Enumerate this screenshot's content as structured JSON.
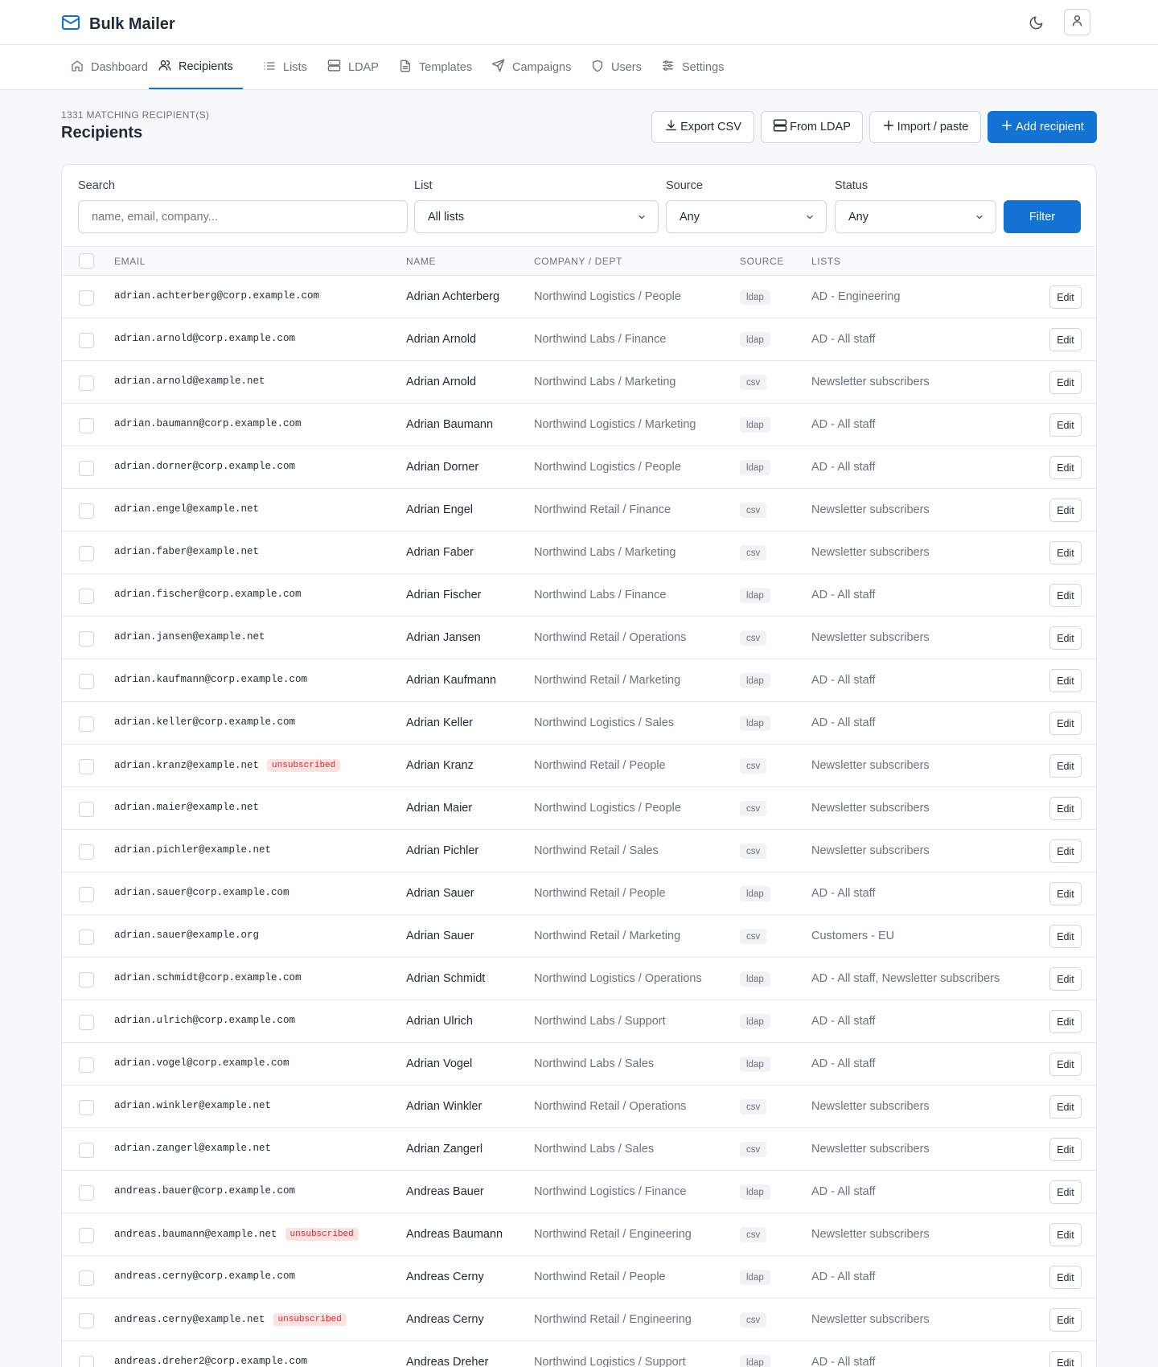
{
  "app": {
    "title": "Bulk Mailer"
  },
  "nav": {
    "tabs": [
      {
        "label": "Dashboard",
        "icon": "home-icon"
      },
      {
        "label": "Recipients",
        "icon": "users-icon",
        "active": true
      },
      {
        "label": "Lists",
        "icon": "list-icon"
      },
      {
        "label": "LDAP",
        "icon": "server-icon"
      },
      {
        "label": "Templates",
        "icon": "file-icon"
      },
      {
        "label": "Campaigns",
        "icon": "send-icon"
      },
      {
        "label": "Users",
        "icon": "shield-icon"
      },
      {
        "label": "Settings",
        "icon": "sliders-icon"
      }
    ]
  },
  "header": {
    "count_label": "1331 MATCHING RECIPIENT(S)",
    "title": "Recipients",
    "buttons": {
      "export": "Export CSV",
      "ldap": "From LDAP",
      "import": "Import / paste",
      "add": "Add recipient"
    }
  },
  "filters": {
    "search_label": "Search",
    "search_placeholder": "name, email, company...",
    "list_label": "List",
    "list_value": "All lists",
    "source_label": "Source",
    "source_value": "Any",
    "status_label": "Status",
    "status_value": "Any",
    "filter_button": "Filter"
  },
  "table": {
    "columns": {
      "email": "EMAIL",
      "name": "NAME",
      "company": "COMPANY / DEPT",
      "source": "SOURCE",
      "lists": "LISTS"
    },
    "edit_label": "Edit",
    "unsubscribed_label": "unsubscribed",
    "rows": [
      {
        "email": "adrian.achterberg@corp.example.com",
        "name": "Adrian Achterberg",
        "company": "Northwind Logistics / People",
        "source": "ldap",
        "lists": "AD - Engineering",
        "unsubscribed": false
      },
      {
        "email": "adrian.arnold@corp.example.com",
        "name": "Adrian Arnold",
        "company": "Northwind Labs / Finance",
        "source": "ldap",
        "lists": "AD - All staff",
        "unsubscribed": false
      },
      {
        "email": "adrian.arnold@example.net",
        "name": "Adrian Arnold",
        "company": "Northwind Labs / Marketing",
        "source": "csv",
        "lists": "Newsletter subscribers",
        "unsubscribed": false
      },
      {
        "email": "adrian.baumann@corp.example.com",
        "name": "Adrian Baumann",
        "company": "Northwind Logistics / Marketing",
        "source": "ldap",
        "lists": "AD - All staff",
        "unsubscribed": false
      },
      {
        "email": "adrian.dorner@corp.example.com",
        "name": "Adrian Dorner",
        "company": "Northwind Logistics / People",
        "source": "ldap",
        "lists": "AD - All staff",
        "unsubscribed": false
      },
      {
        "email": "adrian.engel@example.net",
        "name": "Adrian Engel",
        "company": "Northwind Retail / Finance",
        "source": "csv",
        "lists": "Newsletter subscribers",
        "unsubscribed": false
      },
      {
        "email": "adrian.faber@example.net",
        "name": "Adrian Faber",
        "company": "Northwind Labs / Marketing",
        "source": "csv",
        "lists": "Newsletter subscribers",
        "unsubscribed": false
      },
      {
        "email": "adrian.fischer@corp.example.com",
        "name": "Adrian Fischer",
        "company": "Northwind Labs / Finance",
        "source": "ldap",
        "lists": "AD - All staff",
        "unsubscribed": false
      },
      {
        "email": "adrian.jansen@example.net",
        "name": "Adrian Jansen",
        "company": "Northwind Retail / Operations",
        "source": "csv",
        "lists": "Newsletter subscribers",
        "unsubscribed": false
      },
      {
        "email": "adrian.kaufmann@corp.example.com",
        "name": "Adrian Kaufmann",
        "company": "Northwind Retail / Marketing",
        "source": "ldap",
        "lists": "AD - All staff",
        "unsubscribed": false
      },
      {
        "email": "adrian.keller@corp.example.com",
        "name": "Adrian Keller",
        "company": "Northwind Logistics / Sales",
        "source": "ldap",
        "lists": "AD - All staff",
        "unsubscribed": false
      },
      {
        "email": "adrian.kranz@example.net",
        "name": "Adrian Kranz",
        "company": "Northwind Retail / People",
        "source": "csv",
        "lists": "Newsletter subscribers",
        "unsubscribed": true
      },
      {
        "email": "adrian.maier@example.net",
        "name": "Adrian Maier",
        "company": "Northwind Logistics / People",
        "source": "csv",
        "lists": "Newsletter subscribers",
        "unsubscribed": false
      },
      {
        "email": "adrian.pichler@example.net",
        "name": "Adrian Pichler",
        "company": "Northwind Retail / Sales",
        "source": "csv",
        "lists": "Newsletter subscribers",
        "unsubscribed": false
      },
      {
        "email": "adrian.sauer@corp.example.com",
        "name": "Adrian Sauer",
        "company": "Northwind Retail / People",
        "source": "ldap",
        "lists": "AD - All staff",
        "unsubscribed": false
      },
      {
        "email": "adrian.sauer@example.org",
        "name": "Adrian Sauer",
        "company": "Northwind Retail / Marketing",
        "source": "csv",
        "lists": "Customers - EU",
        "unsubscribed": false
      },
      {
        "email": "adrian.schmidt@corp.example.com",
        "name": "Adrian Schmidt",
        "company": "Northwind Logistics / Operations",
        "source": "ldap",
        "lists": "AD - All staff, Newsletter subscribers",
        "unsubscribed": false
      },
      {
        "email": "adrian.ulrich@corp.example.com",
        "name": "Adrian Ulrich",
        "company": "Northwind Labs / Support",
        "source": "ldap",
        "lists": "AD - All staff",
        "unsubscribed": false
      },
      {
        "email": "adrian.vogel@corp.example.com",
        "name": "Adrian Vogel",
        "company": "Northwind Labs / Sales",
        "source": "ldap",
        "lists": "AD - All staff",
        "unsubscribed": false
      },
      {
        "email": "adrian.winkler@example.net",
        "name": "Adrian Winkler",
        "company": "Northwind Retail / Operations",
        "source": "csv",
        "lists": "Newsletter subscribers",
        "unsubscribed": false
      },
      {
        "email": "adrian.zangerl@example.net",
        "name": "Adrian Zangerl",
        "company": "Northwind Labs / Sales",
        "source": "csv",
        "lists": "Newsletter subscribers",
        "unsubscribed": false
      },
      {
        "email": "andreas.bauer@corp.example.com",
        "name": "Andreas Bauer",
        "company": "Northwind Logistics / Finance",
        "source": "ldap",
        "lists": "AD - All staff",
        "unsubscribed": false
      },
      {
        "email": "andreas.baumann@example.net",
        "name": "Andreas Baumann",
        "company": "Northwind Retail / Engineering",
        "source": "csv",
        "lists": "Newsletter subscribers",
        "unsubscribed": true
      },
      {
        "email": "andreas.cerny@corp.example.com",
        "name": "Andreas Cerny",
        "company": "Northwind Retail / People",
        "source": "ldap",
        "lists": "AD - All staff",
        "unsubscribed": false
      },
      {
        "email": "andreas.cerny@example.net",
        "name": "Andreas Cerny",
        "company": "Northwind Retail / Engineering",
        "source": "csv",
        "lists": "Newsletter subscribers",
        "unsubscribed": true
      },
      {
        "email": "andreas.dreher2@corp.example.com",
        "name": "Andreas Dreher",
        "company": "Northwind Logistics / Support",
        "source": "ldap",
        "lists": "AD - All staff",
        "unsubscribed": false
      }
    ]
  }
}
